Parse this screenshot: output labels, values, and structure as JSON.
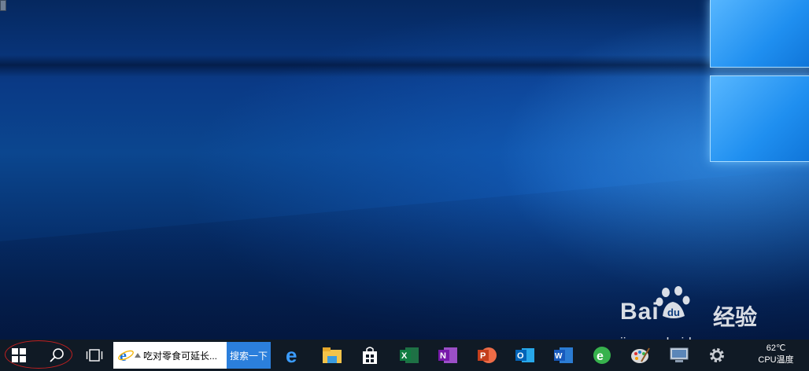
{
  "desktop": {
    "wallpaper": "windows-10-hero"
  },
  "watermark": {
    "brand_latin": "Bai",
    "brand_du": "du",
    "brand_cn": "经验",
    "url": "jingyan.baidu.com"
  },
  "taskbar": {
    "search": {
      "text": "吃对零食可延长...",
      "button_label": "搜索一下"
    },
    "tray": {
      "temperature": "62℃",
      "temperature_label": "CPU温度"
    },
    "apps": [
      {
        "name": "edge-icon"
      },
      {
        "name": "file-explorer-icon"
      },
      {
        "name": "store-icon"
      },
      {
        "name": "excel-icon"
      },
      {
        "name": "onenote-icon"
      },
      {
        "name": "powerpoint-icon"
      },
      {
        "name": "outlook-icon"
      },
      {
        "name": "word-icon"
      },
      {
        "name": "green-e-icon"
      },
      {
        "name": "paint-icon"
      },
      {
        "name": "monitor-icon"
      },
      {
        "name": "settings-icon"
      }
    ]
  },
  "colors": {
    "taskbar": "#101a25",
    "accent": "#2b7fdc",
    "wallpaper_light": "#58b7ff"
  }
}
